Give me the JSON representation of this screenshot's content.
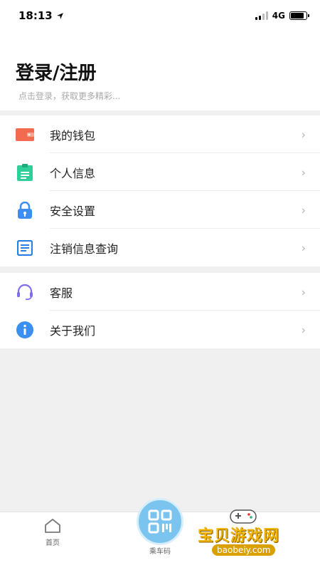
{
  "status_bar": {
    "time": "18:13",
    "network": "4G"
  },
  "header": {
    "title": "登录/注册",
    "subtitle": "点击登录，获取更多精彩..."
  },
  "menu_group_1": [
    {
      "label": "我的钱包",
      "icon": "wallet-icon"
    },
    {
      "label": "个人信息",
      "icon": "id-card-icon"
    },
    {
      "label": "安全设置",
      "icon": "lock-icon"
    },
    {
      "label": "注销信息查询",
      "icon": "document-icon"
    }
  ],
  "menu_group_2": [
    {
      "label": "客服",
      "icon": "headset-icon"
    },
    {
      "label": "关于我们",
      "icon": "info-icon"
    }
  ],
  "tabbar": {
    "home_label": "首页",
    "qr_label": "乘车码"
  },
  "watermark": {
    "text": "宝贝游戏网",
    "url": "baobeiy.com"
  },
  "colors": {
    "accent": "#7cc4f0",
    "wallet": "#f26b50",
    "idcard": "#2fcf9a",
    "lock": "#3d8ef0",
    "doc": "#2a7fe0",
    "headset": "#7d6ef0",
    "info": "#3a8ff0"
  }
}
